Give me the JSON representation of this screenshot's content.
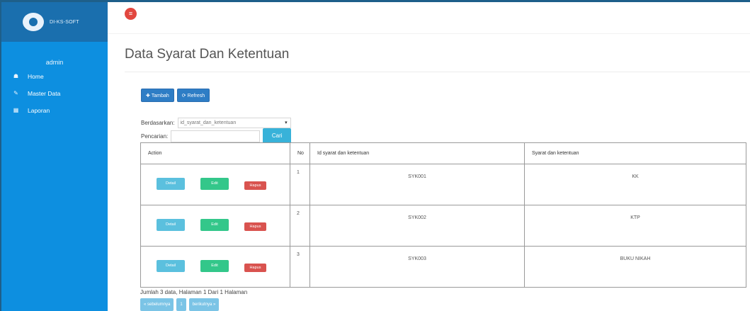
{
  "brand": {
    "name": "DI-KS-SOFT"
  },
  "sidebar": {
    "user": "admin",
    "items": [
      {
        "label": "Home",
        "icon": "home-icon"
      },
      {
        "label": "Master Data",
        "icon": "edit-icon"
      },
      {
        "label": "Laporan",
        "icon": "calendar-icon"
      }
    ]
  },
  "header": {
    "toggle_icon": "menu-icon"
  },
  "page": {
    "title": "Data Syarat Dan Ketentuan"
  },
  "toolbar": {
    "add_label": "Tambah",
    "refresh_label": "Refresh"
  },
  "filter": {
    "label": "Berdasarkan:",
    "selected": "id_syarat_dan_ketentuan",
    "search_label": "Pencarian:",
    "search_value": "",
    "search_button": "Cari"
  },
  "table": {
    "headers": [
      "Action",
      "No",
      "Id syarat dan ketentuan",
      "Syarat dan ketentuan"
    ],
    "action_labels": {
      "detail": "Detail",
      "edit": "Edit",
      "hapus": "Hapus"
    },
    "rows": [
      {
        "no": "1",
        "id": "SYK001",
        "syarat": "KK"
      },
      {
        "no": "2",
        "id": "SYK002",
        "syarat": "KTP"
      },
      {
        "no": "3",
        "id": "SYK003",
        "syarat": "BUKU NIKAH"
      }
    ]
  },
  "footer": {
    "summary": "Jumlah 3 data, Halaman 1 Dari 1 Halaman",
    "prev": "« sebelumnya",
    "page": "1",
    "next": "berikutnya »"
  },
  "colors": {
    "sidebar": "#0d8fe0",
    "brand": "#1a6fae",
    "primary": "#2e7dc5",
    "info": "#5bc0de",
    "success": "#33c78a",
    "danger": "#d9534f"
  }
}
